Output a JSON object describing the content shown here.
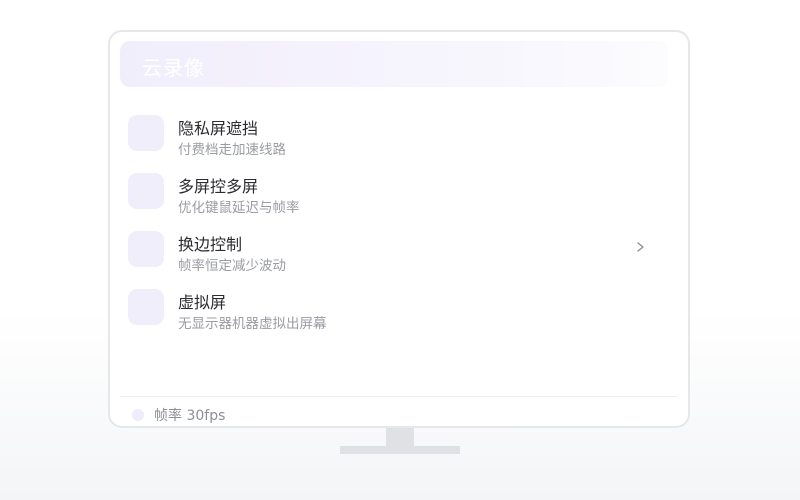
{
  "window": {
    "title": "云录像"
  },
  "features": [
    {
      "name": "隐私屏遮挡",
      "description": "付费档走加速线路",
      "icon": "feature-tile-icon"
    },
    {
      "name": "多屏控多屏",
      "description": "优化键鼠延迟与帧率",
      "icon": "feature-tile-icon"
    },
    {
      "name": "换边控制",
      "description": "帧率恒定减少波动",
      "icon": "feature-tile-icon",
      "chevron": "›"
    },
    {
      "name": "虚拟屏",
      "description": "无显示器机器虚拟出屏幕",
      "icon": "feature-tile-icon"
    }
  ],
  "status": {
    "text": "帧率 30fps",
    "indicator": "status-dot-icon"
  },
  "colors": {
    "title_bar": "#f1eefc",
    "tile": "#f1eefb",
    "primary_text": "#2b2b31",
    "secondary_text": "#9a9ca3",
    "border": "#e6e7ea",
    "stand": "#dfe1e4"
  }
}
